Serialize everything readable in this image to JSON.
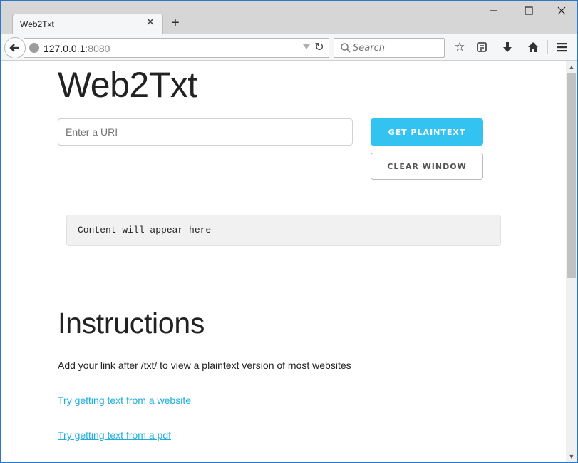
{
  "browser": {
    "tab_title": "Web2Txt",
    "tab_close_icon": "close-icon",
    "new_tab_icon": "plus-icon",
    "url_host": "127.0.0.1",
    "url_port": ":8080",
    "search_placeholder": "Search",
    "window_controls": [
      "minimize-icon",
      "maximize-icon",
      "close-icon"
    ],
    "toolbar_icons": [
      "bookmark-star-icon",
      "reading-list-icon",
      "download-icon",
      "home-icon",
      "menu-icon"
    ]
  },
  "page": {
    "title": "Web2Txt",
    "uri_placeholder": "Enter a URI",
    "get_button": "GET PLAINTEXT",
    "clear_button": "CLEAR WINDOW",
    "output_text": "Content will appear here",
    "instructions_heading": "Instructions",
    "instructions_text": "Add your link after /txt/ to view a plaintext version of most websites",
    "links": [
      "Try getting text from a website",
      "Try getting text from a pdf"
    ]
  },
  "colors": {
    "accent": "#33c3f0",
    "link": "#1eaedb",
    "text": "#222222"
  }
}
